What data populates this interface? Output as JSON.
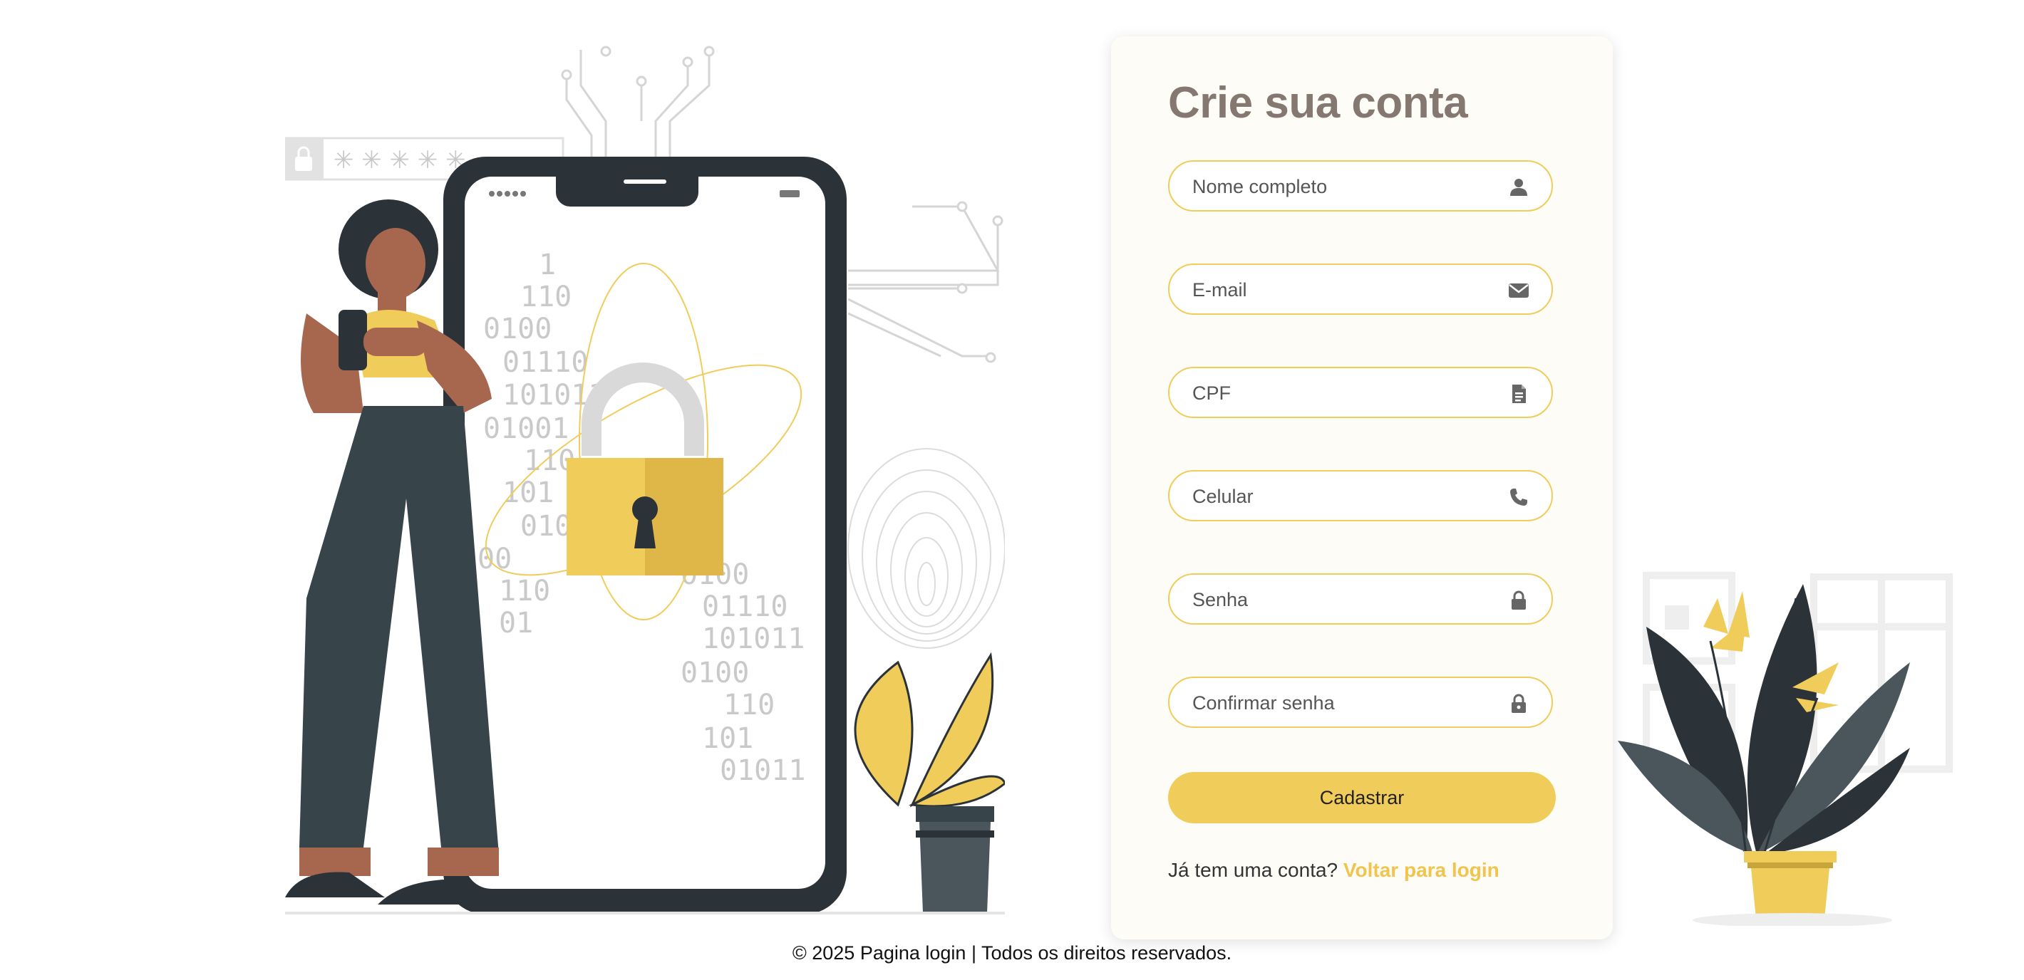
{
  "colors": {
    "accent": "#f0cc5b",
    "link": "#f0c44d",
    "title": "#857871",
    "card_bg": "#fdfcf7"
  },
  "form": {
    "title": "Crie sua conta",
    "fields": [
      {
        "placeholder": "Nome completo",
        "icon": "user-icon"
      },
      {
        "placeholder": "E-mail",
        "icon": "envelope-icon"
      },
      {
        "placeholder": "CPF",
        "icon": "document-icon"
      },
      {
        "placeholder": "Celular",
        "icon": "phone-icon"
      },
      {
        "placeholder": "Senha",
        "icon": "lock-icon"
      },
      {
        "placeholder": "Confirmar senha",
        "icon": "lock-icon"
      }
    ],
    "submit_label": "Cadastrar",
    "signin_prompt": "Já tem uma conta? ",
    "signin_link": "Voltar para login"
  },
  "illustration": {
    "password_mask": "✳ ✳ ✳ ✳ ✳",
    "binary_rows": [
      "1",
      "110",
      "0100",
      "01110",
      "101011",
      "01001",
      "110",
      "101",
      "010",
      "00",
      "110",
      "01",
      "0100",
      "01110",
      "101011",
      "0100",
      "110",
      "101",
      "01011"
    ]
  },
  "footer": {
    "text": "© 2025 Pagina login | Todos os direitos reservados."
  }
}
